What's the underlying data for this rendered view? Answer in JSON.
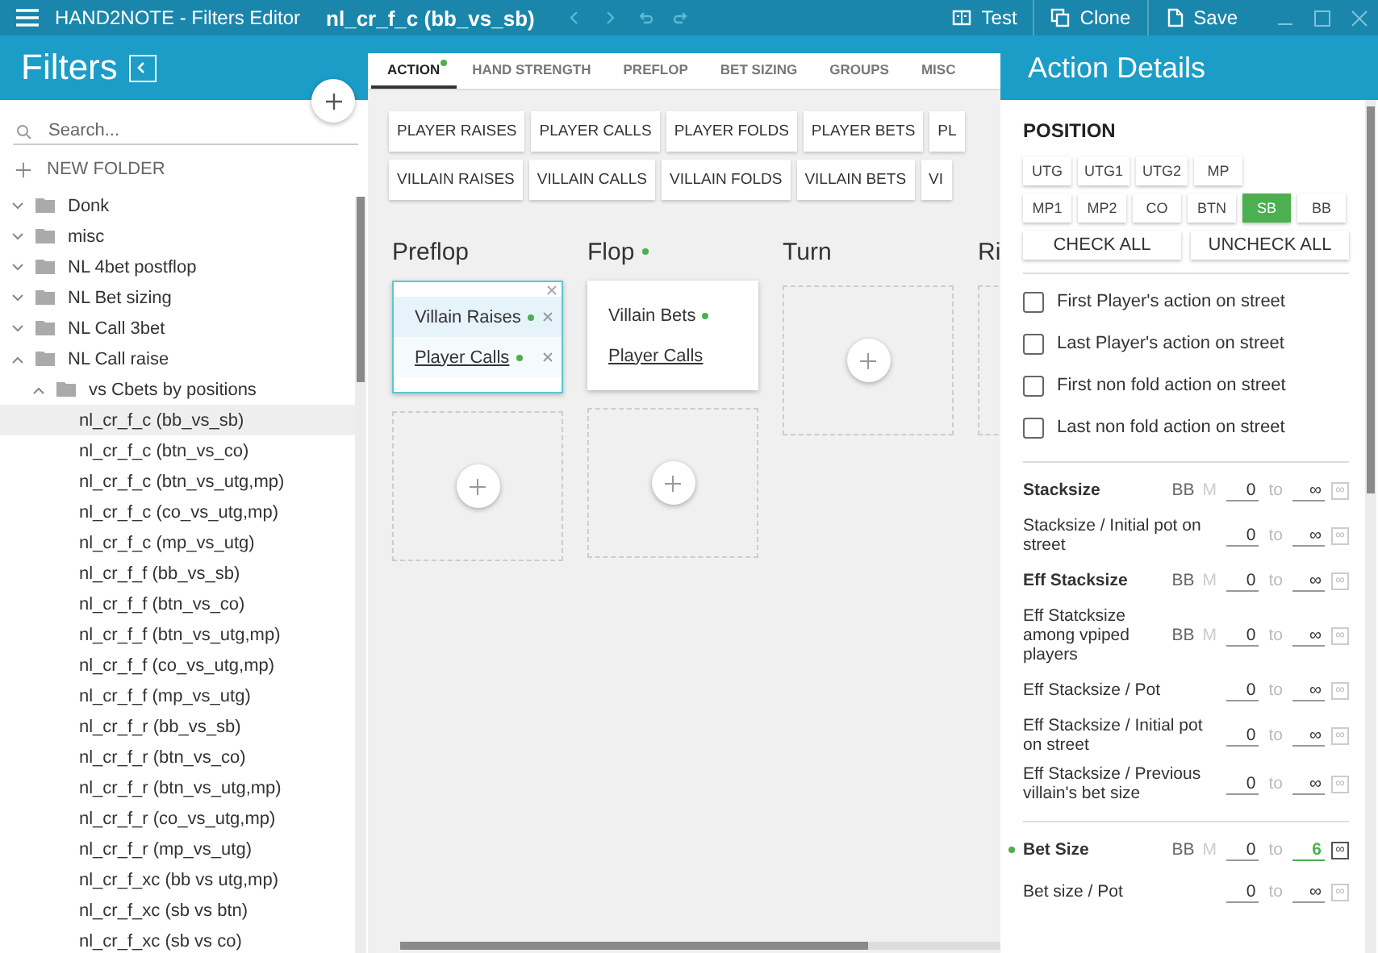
{
  "titlebar": {
    "app_title": "HAND2NOTE - Filters Editor",
    "filter_name": "nl_cr_f_c (bb_vs_sb)",
    "buttons": [
      {
        "label": "Test",
        "kind": "test"
      },
      {
        "label": "Clone",
        "kind": "clone"
      },
      {
        "label": "Save",
        "kind": "save"
      }
    ]
  },
  "filters_panel": {
    "title": "Filters",
    "search": {
      "placeholder": "Search..."
    },
    "new_folder": "NEW FOLDER",
    "tree": [
      {
        "label": "Donk",
        "expanded": false
      },
      {
        "label": "misc",
        "expanded": false
      },
      {
        "label": "NL 4bet postflop",
        "expanded": false
      },
      {
        "label": "NL Bet sizing",
        "expanded": false
      },
      {
        "label": "NL Call 3bet",
        "expanded": false
      },
      {
        "label": "NL Call raise",
        "expanded": true,
        "children": [
          {
            "label": "vs Cbets by positions",
            "expanded": true,
            "children": [
              {
                "label": "nl_cr_f_c (bb_vs_sb)",
                "selected": true
              },
              {
                "label": "nl_cr_f_c (btn_vs_co)",
                "selected": false
              },
              {
                "label": "nl_cr_f_c (btn_vs_utg,mp)",
                "selected": false
              },
              {
                "label": "nl_cr_f_c (co_vs_utg,mp)",
                "selected": false
              },
              {
                "label": "nl_cr_f_c (mp_vs_utg)",
                "selected": false
              },
              {
                "label": "nl_cr_f_f (bb_vs_sb)",
                "selected": false
              },
              {
                "label": "nl_cr_f_f (btn_vs_co)",
                "selected": false
              },
              {
                "label": "nl_cr_f_f (btn_vs_utg,mp)",
                "selected": false
              },
              {
                "label": "nl_cr_f_f (co_vs_utg,mp)",
                "selected": false
              },
              {
                "label": "nl_cr_f_f (mp_vs_utg)",
                "selected": false
              },
              {
                "label": "nl_cr_f_r (bb_vs_sb)",
                "selected": false
              },
              {
                "label": "nl_cr_f_r (btn_vs_co)",
                "selected": false
              },
              {
                "label": "nl_cr_f_r (btn_vs_utg,mp)",
                "selected": false
              },
              {
                "label": "nl_cr_f_r (co_vs_utg,mp)",
                "selected": false
              },
              {
                "label": "nl_cr_f_r (mp_vs_utg)",
                "selected": false
              },
              {
                "label": "nl_cr_f_xc (bb vs utg,mp)",
                "selected": false
              },
              {
                "label": "nl_cr_f_xc (sb vs btn)",
                "selected": false
              },
              {
                "label": "nl_cr_f_xc (sb vs co)",
                "selected": false
              }
            ]
          }
        ]
      }
    ]
  },
  "editor": {
    "tabs": [
      {
        "label": "ACTION",
        "selected": true,
        "dot": true
      },
      {
        "label": "HAND STRENGTH",
        "selected": false,
        "dot": false
      },
      {
        "label": "PREFLOP",
        "selected": false,
        "dot": false
      },
      {
        "label": "BET SIZING",
        "selected": false,
        "dot": false
      },
      {
        "label": "GROUPS",
        "selected": false,
        "dot": false
      },
      {
        "label": "MISC",
        "selected": false,
        "dot": false
      }
    ],
    "action_buttons": [
      [
        "PLAYER RAISES",
        "PLAYER CALLS",
        "PLAYER FOLDS",
        "PLAYER BETS",
        "PL"
      ],
      [
        "VILLAIN RAISES",
        "VILLAIN CALLS",
        "VILLAIN FOLDS",
        "VILLAIN BETS",
        "VI"
      ]
    ],
    "streets": [
      {
        "name": "Preflop",
        "dot": false,
        "cards": [
          {
            "selected": true,
            "conditions": [
              {
                "label": "Villain Raises",
                "dot": true,
                "underlined": false,
                "selected": true
              },
              {
                "label": "Player Calls",
                "dot": true,
                "underlined": true,
                "selected": false
              }
            ]
          }
        ]
      },
      {
        "name": "Flop",
        "dot": true,
        "cards": [
          {
            "selected": false,
            "conditions": [
              {
                "label": "Villain Bets",
                "dot": true,
                "underlined": false,
                "selected": false
              },
              {
                "label": "Player Calls",
                "dot": false,
                "underlined": true,
                "selected": false
              }
            ]
          }
        ]
      },
      {
        "name": "Turn",
        "dot": false
      },
      {
        "name": "Ri",
        "dot": false
      }
    ]
  },
  "details": {
    "title": "Action Details",
    "position_heading": "POSITION",
    "positions": [
      [
        {
          "label": "UTG",
          "selected": false
        },
        {
          "label": "UTG1",
          "selected": false
        },
        {
          "label": "UTG2",
          "selected": false
        },
        {
          "label": "MP",
          "selected": false
        }
      ],
      [
        {
          "label": "MP1",
          "selected": false
        },
        {
          "label": "MP2",
          "selected": false
        },
        {
          "label": "CO",
          "selected": false
        },
        {
          "label": "BTN",
          "selected": false
        },
        {
          "label": "SB",
          "selected": true
        },
        {
          "label": "BB",
          "selected": false
        }
      ]
    ],
    "check_all": "CHECK ALL",
    "uncheck_all": "UNCHECK ALL",
    "checkboxes": [
      {
        "label": "First Player's action on street",
        "checked": false
      },
      {
        "label": "Last Player's action on street",
        "checked": false
      },
      {
        "label": "First non fold action on street",
        "checked": false
      },
      {
        "label": "Last non fold action on street",
        "checked": false
      }
    ],
    "ranges": [
      {
        "label": "Stacksize",
        "bold": true,
        "dot": false,
        "units": [
          {
            "label": "BB",
            "selected": true
          },
          {
            "label": "M",
            "selected": false
          }
        ],
        "from": "0",
        "sep": "to",
        "to": "∞",
        "toggle": "∞",
        "toggle_on": false
      },
      {
        "label": "Stacksize / Initial pot on street",
        "bold": false,
        "dot": false,
        "from": "0",
        "sep": "to",
        "to": "∞",
        "toggle": "∞",
        "toggle_on": false
      },
      {
        "label": "Eff Stacksize",
        "bold": true,
        "dot": false,
        "units": [
          {
            "label": "BB",
            "selected": true
          },
          {
            "label": "M",
            "selected": false
          }
        ],
        "from": "0",
        "sep": "to",
        "to": "∞",
        "toggle": "∞",
        "toggle_on": false
      },
      {
        "label": "Eff Statcksize among vpiped players",
        "bold": false,
        "dot": false,
        "units": [
          {
            "label": "BB",
            "selected": true
          },
          {
            "label": "M",
            "selected": false
          }
        ],
        "from": "0",
        "sep": "to",
        "to": "∞",
        "toggle": "∞",
        "toggle_on": false
      },
      {
        "label": "Eff Stacksize / Pot",
        "bold": false,
        "dot": false,
        "from": "0",
        "sep": "to",
        "to": "∞",
        "toggle": "∞",
        "toggle_on": false
      },
      {
        "label": "Eff Stacksize / Initial pot on street",
        "bold": false,
        "dot": false,
        "from": "0",
        "sep": "to",
        "to": "∞",
        "toggle": "∞",
        "toggle_on": false
      },
      {
        "label": "Eff Stacksize / Previous villain's bet size",
        "bold": false,
        "dot": false,
        "from": "0",
        "sep": "to",
        "to": "∞",
        "toggle": "∞",
        "toggle_on": false
      },
      {
        "label": "Bet Size",
        "bold": true,
        "dot": true,
        "units": [
          {
            "label": "BB",
            "selected": true
          },
          {
            "label": "M",
            "selected": false
          }
        ],
        "from": "0",
        "sep": "to",
        "to": "6",
        "toggle": "∞",
        "toggle_on": true,
        "divider_before": true
      },
      {
        "label": "Bet size / Pot",
        "bold": false,
        "dot": false,
        "from": "0",
        "sep": "to",
        "to": "∞",
        "toggle": "∞",
        "toggle_on": false
      }
    ]
  }
}
